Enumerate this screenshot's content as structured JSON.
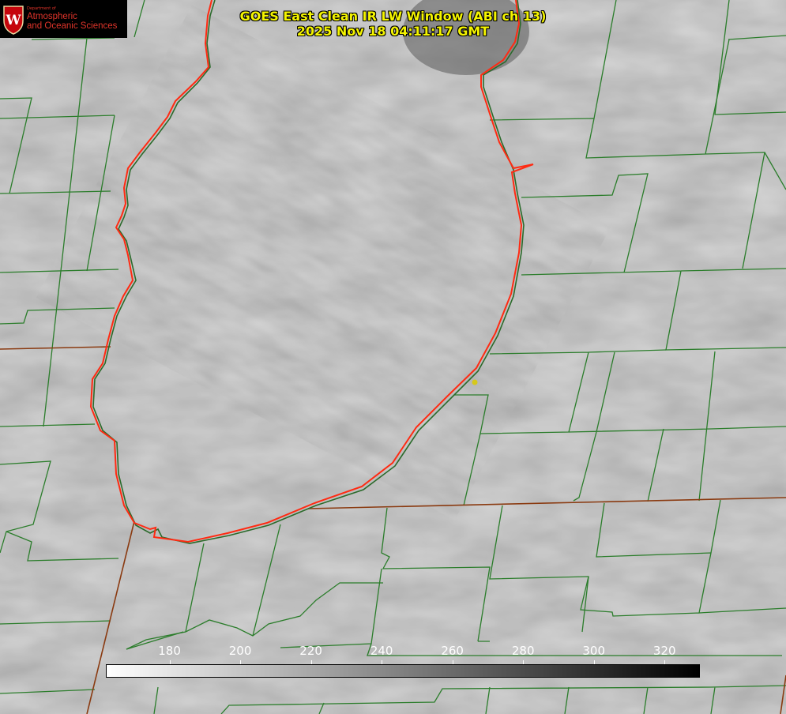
{
  "title": {
    "line1": "GOES East Clean IR LW Window (ABI ch 13)",
    "line2": "2025 Nov 18 04:11:17 GMT",
    "color": "#f4f400"
  },
  "logo": {
    "dept": "Department of",
    "line1": "Atmospheric",
    "line2": "and Oceanic Sciences",
    "seal_letter": "W",
    "seal_color": "#c5050c",
    "text_color": "#e0342a"
  },
  "colorbar": {
    "ticks": [
      "180",
      "200",
      "220",
      "240",
      "260",
      "280",
      "300",
      "320"
    ],
    "min": 162,
    "max": 330,
    "gradient": [
      "#ffffff",
      "#000000"
    ]
  },
  "map": {
    "lake_outline_color": "#ff2a12",
    "county_line_color": "#2b7d2b",
    "state_line_color": "#8a3a10",
    "station_marker_color": "#d6c81a",
    "icon": "lake-outline"
  }
}
